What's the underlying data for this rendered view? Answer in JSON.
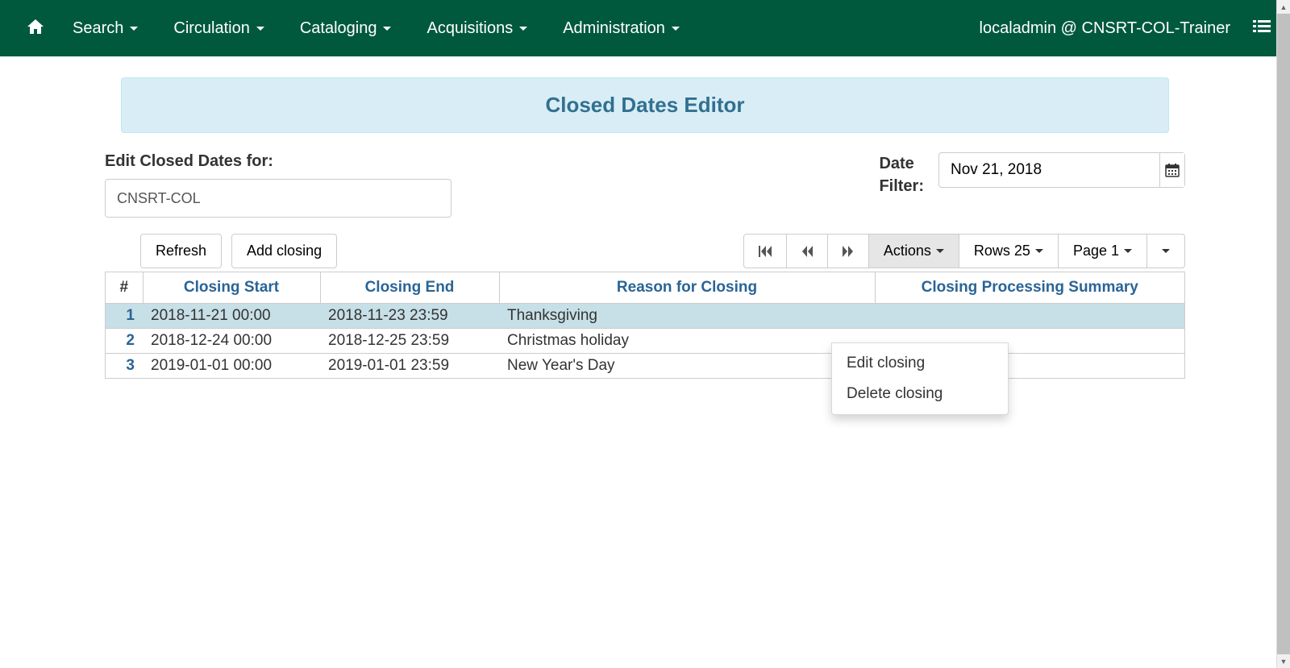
{
  "navbar": {
    "home_icon": "home",
    "items": [
      {
        "label": "Search"
      },
      {
        "label": "Circulation"
      },
      {
        "label": "Cataloging"
      },
      {
        "label": "Acquisitions"
      },
      {
        "label": "Administration"
      }
    ],
    "user_label": "localadmin @ CNSRT-COL-Trainer"
  },
  "page_title": "Closed Dates Editor",
  "edit_for": {
    "label": "Edit Closed Dates for:",
    "value": "CNSRT-COL"
  },
  "date_filter": {
    "label_line1": "Date",
    "label_line2": "Filter:",
    "value": "Nov 21, 2018"
  },
  "buttons": {
    "refresh": "Refresh",
    "add_closing": "Add closing",
    "actions": "Actions",
    "rows": "Rows 25",
    "page": "Page 1"
  },
  "actions_menu": {
    "edit": "Edit closing",
    "delete": "Delete closing"
  },
  "table": {
    "headers": {
      "num": "#",
      "start": "Closing Start",
      "end": "Closing End",
      "reason": "Reason for Closing",
      "summary": "Closing Processing Summary"
    },
    "rows": [
      {
        "num": "1",
        "start": "2018-11-21 00:00",
        "end": "2018-11-23 23:59",
        "reason": "Thanksgiving",
        "summary": "",
        "selected": true
      },
      {
        "num": "2",
        "start": "2018-12-24 00:00",
        "end": "2018-12-25 23:59",
        "reason": "Christmas holiday",
        "summary": "",
        "selected": false
      },
      {
        "num": "3",
        "start": "2019-01-01 00:00",
        "end": "2019-01-01 23:59",
        "reason": "New Year's Day",
        "summary": "",
        "selected": false
      }
    ]
  }
}
